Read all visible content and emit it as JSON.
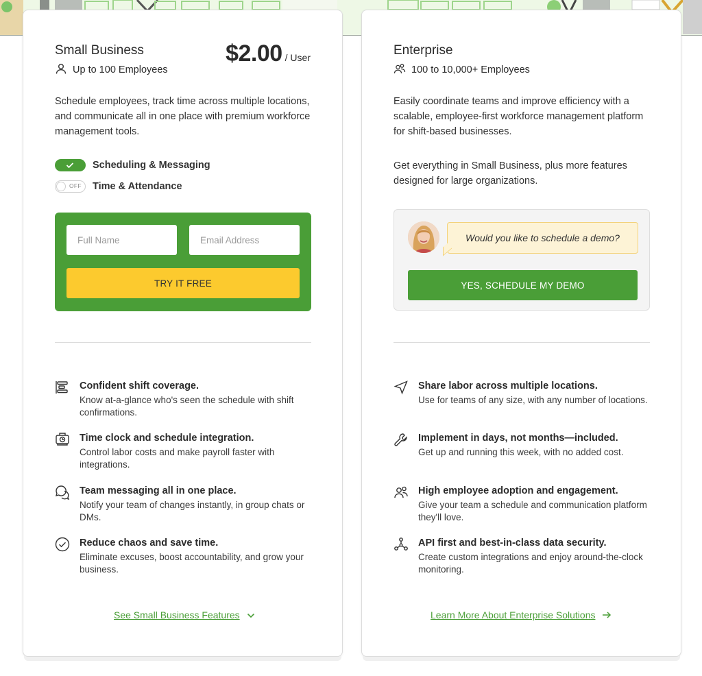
{
  "small_business": {
    "title": "Small Business",
    "subtitle": "Up to 100 Employees",
    "price": "$2.00",
    "price_unit": "/ User",
    "description": "Schedule employees, track time across multiple locations, and communicate all in one place with premium workforce management tools.",
    "toggles": [
      {
        "label": "Scheduling & Messaging",
        "state": "on"
      },
      {
        "label": "Time & Attendance",
        "state": "off",
        "state_label": "OFF"
      }
    ],
    "form": {
      "name_placeholder": "Full Name",
      "email_placeholder": "Email Address",
      "cta_label": "TRY IT FREE"
    },
    "features": [
      {
        "icon": "shift-bars-icon",
        "title": "Confident shift coverage.",
        "text": "Know at-a-glance who's seen the schedule with shift confirmations."
      },
      {
        "icon": "time-clock-icon",
        "title": "Time clock and schedule integration.",
        "text": "Control labor costs and make payroll faster with integrations."
      },
      {
        "icon": "chat-bubbles-icon",
        "title": "Team messaging all in one place.",
        "text": "Notify your team of changes instantly, in group chats or DMs."
      },
      {
        "icon": "check-circle-icon",
        "title": "Reduce chaos and save time.",
        "text": "Eliminate excuses, boost accountability, and grow your business."
      }
    ],
    "footer_link": "See Small Business Features"
  },
  "enterprise": {
    "title": "Enterprise",
    "subtitle": "100 to 10,000+ Employees",
    "description": "Easily coordinate teams and improve efficiency with a scalable, employee-first workforce management platform for shift-based businesses.",
    "description2": "Get everything in Small Business, plus more features designed for large organizations.",
    "demo": {
      "question": "Would you like to schedule a demo?",
      "cta_label": "YES, SCHEDULE MY DEMO"
    },
    "features": [
      {
        "icon": "location-arrow-icon",
        "title": "Share labor across multiple locations.",
        "text": "Use for teams of any size, with any number of locations."
      },
      {
        "icon": "wrench-icon",
        "title": "Implement in days, not months—included.",
        "text": "Get up and running this week, with no added cost."
      },
      {
        "icon": "people-icon",
        "title": "High employee adoption and engagement.",
        "text": "Give your team a schedule and communication platform they'll love."
      },
      {
        "icon": "network-nodes-icon",
        "title": "API first and best-in-class data security.",
        "text": "Create custom integrations and enjoy around-the-clock monitoring."
      }
    ],
    "footer_link": "Learn More About Enterprise Solutions"
  },
  "colors": {
    "brand_green": "#4a9e37",
    "cta_yellow": "#fcca2e",
    "bubble_bg": "#fdf3d6"
  }
}
